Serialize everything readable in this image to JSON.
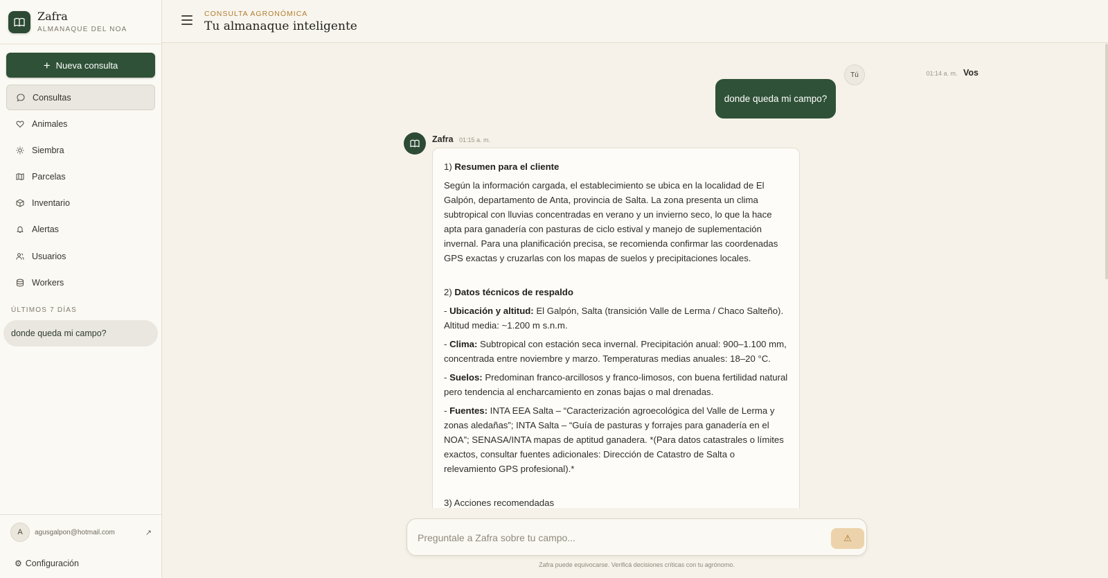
{
  "brand": {
    "name": "Zafra",
    "subtitle": "ALMANAQUE DEL NOA"
  },
  "sidebar": {
    "new_button": "Nueva consulta",
    "items": [
      {
        "label": "Consultas",
        "icon": "chat-bubble-icon",
        "active": true
      },
      {
        "label": "Animales",
        "icon": "heart-icon"
      },
      {
        "label": "Siembra",
        "icon": "sun-icon"
      },
      {
        "label": "Parcelas",
        "icon": "map-icon"
      },
      {
        "label": "Inventario",
        "icon": "box-icon"
      },
      {
        "label": "Alertas",
        "icon": "bell-icon"
      },
      {
        "label": "Usuarios",
        "icon": "users-icon"
      },
      {
        "label": "Workers",
        "icon": "database-icon"
      }
    ],
    "section_label": "ÚLTIMOS 7 DÍAS",
    "history": [
      "donde queda mi campo?"
    ],
    "user_initial": "A",
    "user_email": "agusgalpon@hotmail.com",
    "config_label": "Configuración"
  },
  "header": {
    "eyebrow": "CONSULTA AGRONÓMICA",
    "title": "Tu almanaque inteligente"
  },
  "chat": {
    "user_message": {
      "time": "01:14 a. m.",
      "name": "Vos",
      "avatar": "Tú",
      "text": "donde queda mi campo?"
    },
    "bot_message": {
      "name": "Zafra",
      "time": "01:15 a. m.",
      "s1_prefix": "1) ",
      "s1_title": "Resumen para el cliente",
      "s1_body": "Según la información cargada, el establecimiento se ubica en la localidad de El Galpón, departamento de Anta, provincia de Salta. La zona presenta un clima subtropical con lluvias concentradas en verano y un invierno seco, lo que la hace apta para ganadería con pasturas de ciclo estival y manejo de suplementación invernal. Para una planificación precisa, se recomienda confirmar las coordenadas GPS exactas y cruzarlas con los mapas de suelos y precipitaciones locales.",
      "s2_prefix": "2) ",
      "s2_title": "Datos técnicos de respaldo",
      "bullets": [
        {
          "label": "Ubicación y altitud:",
          "text": " El Galpón, Salta (transición Valle de Lerma / Chaco Salteño). Altitud media: ~1.200 m s.n.m."
        },
        {
          "label": "Clima:",
          "text": " Subtropical con estación seca invernal. Precipitación anual: 900–1.100 mm, concentrada entre noviembre y marzo. Temperaturas medias anuales: 18–20 °C."
        },
        {
          "label": "Suelos:",
          "text": " Predominan franco-arcillosos y franco-limosos, con buena fertilidad natural pero tendencia al encharcamiento en zonas bajas o mal drenadas."
        },
        {
          "label": "Fuentes:",
          "text": " INTA EEA Salta – “Caracterización agroecológica del Valle de Lerma y zonas aledañas”; INTA Salta – “Guía de pasturas y forrajes para ganadería en el NOA”; SENASA/INTA mapas de aptitud ganadera. *(Para datos catastrales o límites exactos, consultar fuentes adicionales: Dirección de Catastro de Salta o relevamiento GPS profesional).*"
        }
      ],
      "s3_partial": "3) Acciones recomendadas"
    }
  },
  "composer": {
    "placeholder": "Preguntale a Zafra sobre tu campo...",
    "send_icon": "warning-triangle-icon",
    "disclaimer": "Zafra puede equivocarse. Verificá decisiones críticas con tu agrónomo."
  },
  "colors": {
    "accent": "#2f5137",
    "eyebrow": "#b27d2e",
    "background": "#f6f2e9"
  }
}
